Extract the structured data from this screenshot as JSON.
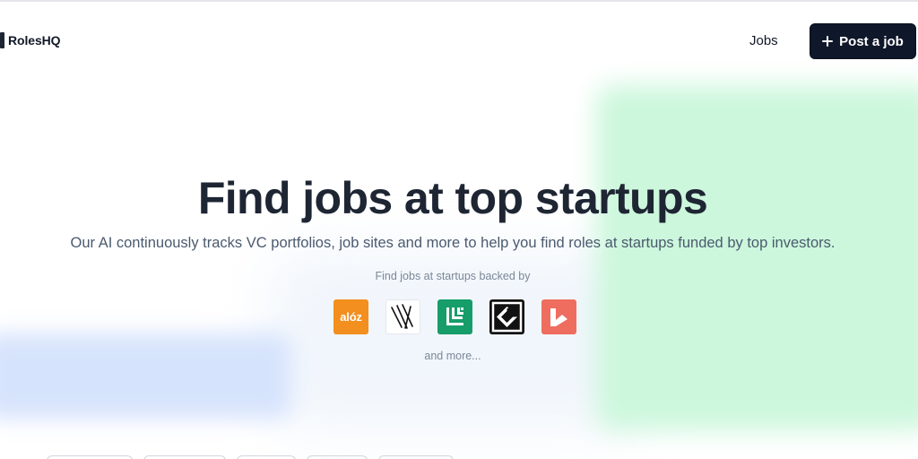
{
  "brand": {
    "name": "RolesHQ"
  },
  "nav": {
    "jobs_label": "Jobs",
    "post_job_label": "Post a job"
  },
  "hero": {
    "title": "Find jobs at top startups",
    "subtitle": "Our AI continuously tracks VC portfolios, job sites and more to help you find roles at startups funded by top investors.",
    "backed_by_label": "Find jobs at startups backed by",
    "investors": [
      {
        "name": "a16z",
        "logo_text": "alóz",
        "color": "#f38f1e"
      },
      {
        "name": "striped-logo",
        "color": "#ffffff"
      },
      {
        "name": "green-logo",
        "color": "#169d6a"
      },
      {
        "name": "black-logo",
        "color": "#111111"
      },
      {
        "name": "red-logo",
        "color": "#ef6d5f"
      }
    ],
    "and_more_label": "and more..."
  },
  "colors": {
    "primary_dark": "#0f172a",
    "heading": "#1e2533",
    "muted": "#7b8797",
    "glow_green": "#ccf7dc",
    "glow_blue": "#d6e3fc"
  }
}
